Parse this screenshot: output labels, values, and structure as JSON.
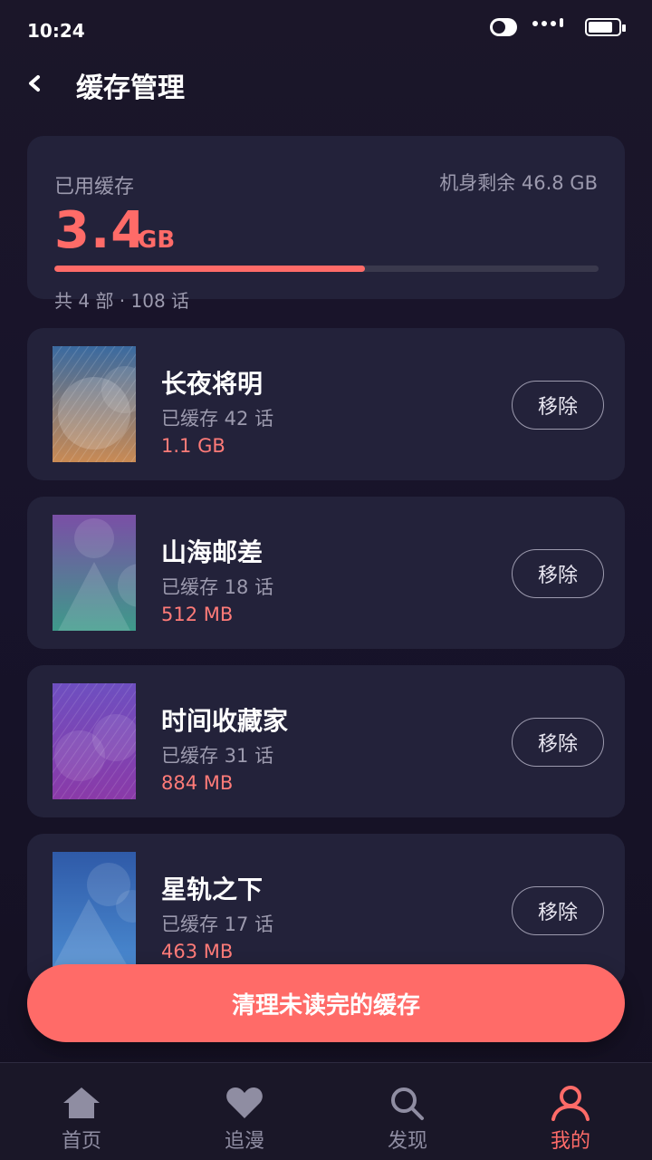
{
  "status_bar": {
    "time": "10:24"
  },
  "header": {
    "title": "缓存管理",
    "back_icon": "chevron-left-icon"
  },
  "summary": {
    "used_label": "已用缓存",
    "used_value": "3.4",
    "used_unit": "GB",
    "free_label": "机身剩余 46.8 GB",
    "usage_fraction": 0.57,
    "meta": "共 4 部 · 108 话"
  },
  "items": [
    {
      "title": "长夜将明",
      "episodes": "已缓存 42 话",
      "size": "1.1 GB",
      "remove_label": "移除",
      "cover_colors": [
        "#3a6aa0",
        "#c98a54"
      ]
    },
    {
      "title": "山海邮差",
      "episodes": "已缓存 18 话",
      "size": "512 MB",
      "remove_label": "移除",
      "cover_colors": [
        "#7a4fa6",
        "#3e9a8a"
      ]
    },
    {
      "title": "时间收藏家",
      "episodes": "已缓存 31 话",
      "size": "884 MB",
      "remove_label": "移除",
      "cover_colors": [
        "#6e4fc0",
        "#8a3aa8"
      ]
    },
    {
      "title": "星轨之下",
      "episodes": "已缓存 17 话",
      "size": "463 MB",
      "remove_label": "移除",
      "cover_colors": [
        "#2f5aa8",
        "#4a8ad0"
      ]
    }
  ],
  "clear_button": {
    "label": "清理未读完的缓存"
  },
  "bottom_nav": [
    {
      "label": "首页",
      "icon": "home-icon",
      "active": false
    },
    {
      "label": "追漫",
      "icon": "heart-icon",
      "active": false
    },
    {
      "label": "发现",
      "icon": "search-icon",
      "active": false
    },
    {
      "label": "我的",
      "icon": "profile-icon",
      "active": true
    }
  ],
  "colors": {
    "accent": "#ff6b68",
    "card": "#23223a",
    "background": "#1b1629",
    "muted_text": "#9c9aae"
  }
}
